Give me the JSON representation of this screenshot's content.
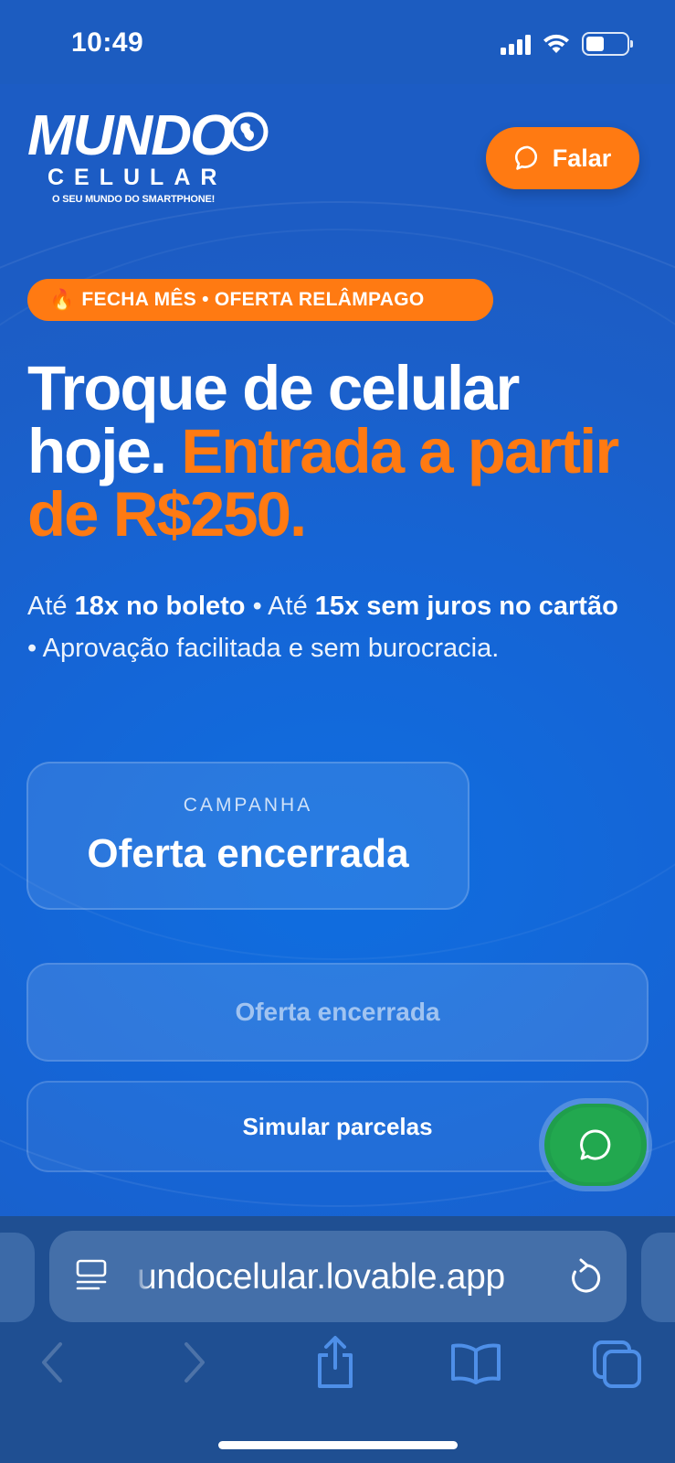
{
  "status_bar": {
    "time": "10:49",
    "icons": [
      "cellular-signal-icon",
      "wifi-icon",
      "battery-icon"
    ]
  },
  "header": {
    "logo": {
      "word": "MUNDO",
      "sub": "CELULAR",
      "tagline": "O SEU MUNDO DO SMARTPHONE!"
    },
    "talk_button": {
      "label": "Falar",
      "icon": "chat-bubble-icon"
    }
  },
  "hero": {
    "badge": {
      "emoji": "🔥",
      "text": "FECHA MÊS • OFERTA RELÂMPAGO"
    },
    "headline_white": "Troque de celular hoje.",
    "headline_orange": "Entrada a partir de R$250.",
    "sub": {
      "p1": "Até ",
      "b1": "18x no boleto",
      "p2": " • Até ",
      "b2": "15x sem juros no cartão",
      "p3": " • Aprovação facilitada e sem burocracia."
    }
  },
  "campaign_card": {
    "kicker": "CAMPANHA",
    "title": "Oferta encerrada"
  },
  "buttons": {
    "offer_closed": "Oferta encerrada",
    "simulate": "Simular parcelas"
  },
  "whatsapp_fab": {
    "icon": "whatsapp-icon"
  },
  "browser": {
    "url": "undocelular.lovable.app",
    "toolbar": [
      "back-icon",
      "forward-icon",
      "share-icon",
      "bookmarks-icon",
      "tabs-icon"
    ]
  },
  "colors": {
    "background": "#1565d6",
    "accent_orange": "#ff7a12",
    "whatsapp_green": "#22a84f",
    "browser_chrome": "#1f4f92"
  }
}
